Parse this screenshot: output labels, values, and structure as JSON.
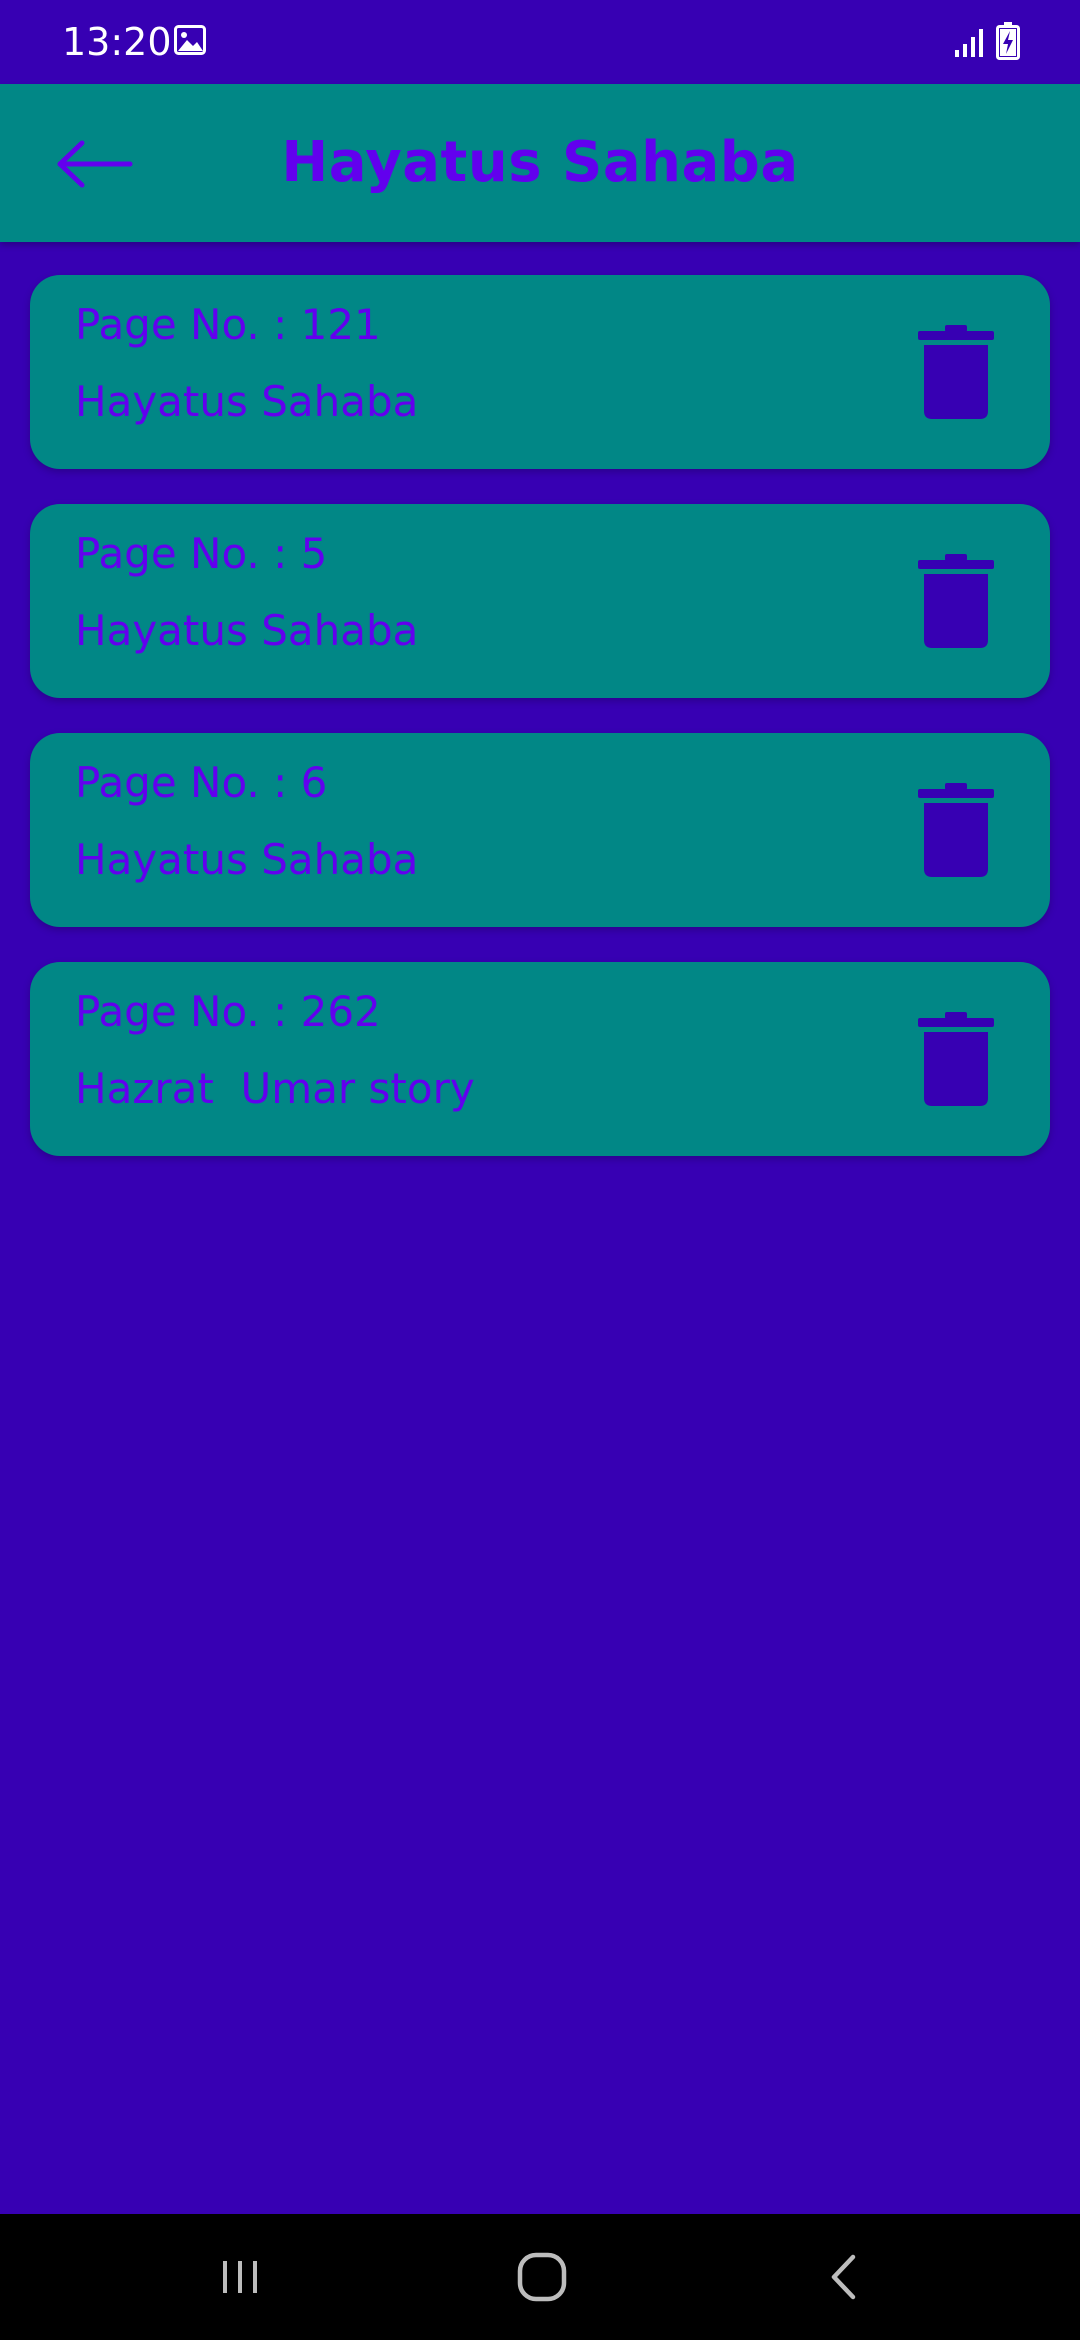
{
  "status_bar": {
    "time": "13:20",
    "icons": [
      "gallery-icon",
      "signal-icon",
      "battery-charging-icon"
    ],
    "color": "#ffffff"
  },
  "app_bar": {
    "title": "Hayatus Sahaba",
    "back_icon": "arrow-left-icon",
    "background": "#018786",
    "title_color": "#6200EE"
  },
  "bookmarks": [
    {
      "page_label": "Page No. : 121",
      "book": "Hayatus Sahaba"
    },
    {
      "page_label": "Page No. : 5",
      "book": "Hayatus Sahaba"
    },
    {
      "page_label": "Page No. : 6",
      "book": "Hayatus Sahaba"
    },
    {
      "page_label": "Page No. : 262",
      "book": "Hazrat  Umar story"
    }
  ],
  "card_delete_icon": "trash-icon",
  "nav_bar": {
    "icons": [
      "recent-apps-icon",
      "home-icon",
      "back-icon"
    ]
  },
  "colors": {
    "background": "#3700B3",
    "card": "#018786",
    "accent_text": "#6200EE",
    "delete_icon": "#3700B3"
  }
}
